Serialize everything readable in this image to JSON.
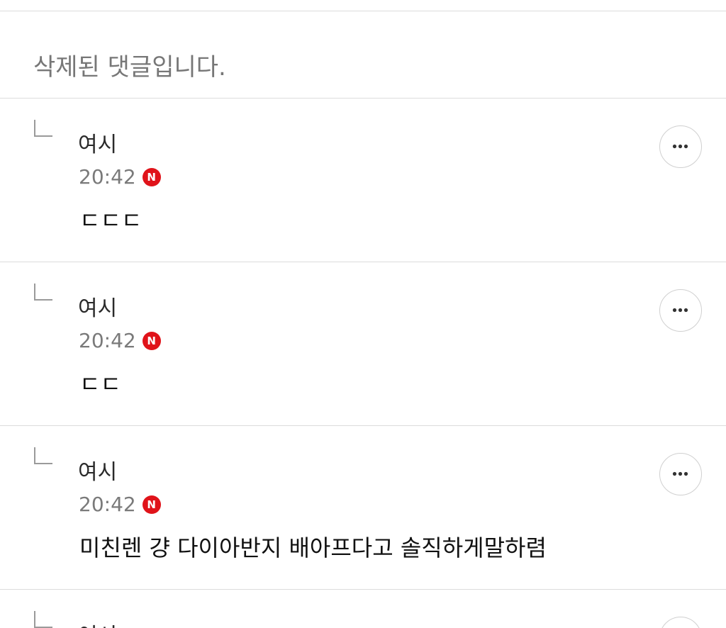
{
  "deleted_notice": "삭제된 댓글입니다.",
  "badge_new": "N",
  "comments": [
    {
      "nickname": "여시",
      "time": "20:42",
      "text": "ㄷㄷㄷ"
    },
    {
      "nickname": "여시",
      "time": "20:42",
      "text": "ㄷㄷ"
    },
    {
      "nickname": "여시",
      "time": "20:42",
      "text": "미친렌 걍 다이아반지 배아프다고 솔직하게말하렴"
    },
    {
      "nickname": "여시",
      "time": "",
      "text": ""
    }
  ],
  "icons": {
    "reply": "reply-arrow-icon",
    "more": "more-options-icon",
    "new": "new-badge-icon"
  },
  "colors": {
    "badge": "#e0131a",
    "divider": "#dcdcdc",
    "muted_text": "#7a7a7a"
  }
}
